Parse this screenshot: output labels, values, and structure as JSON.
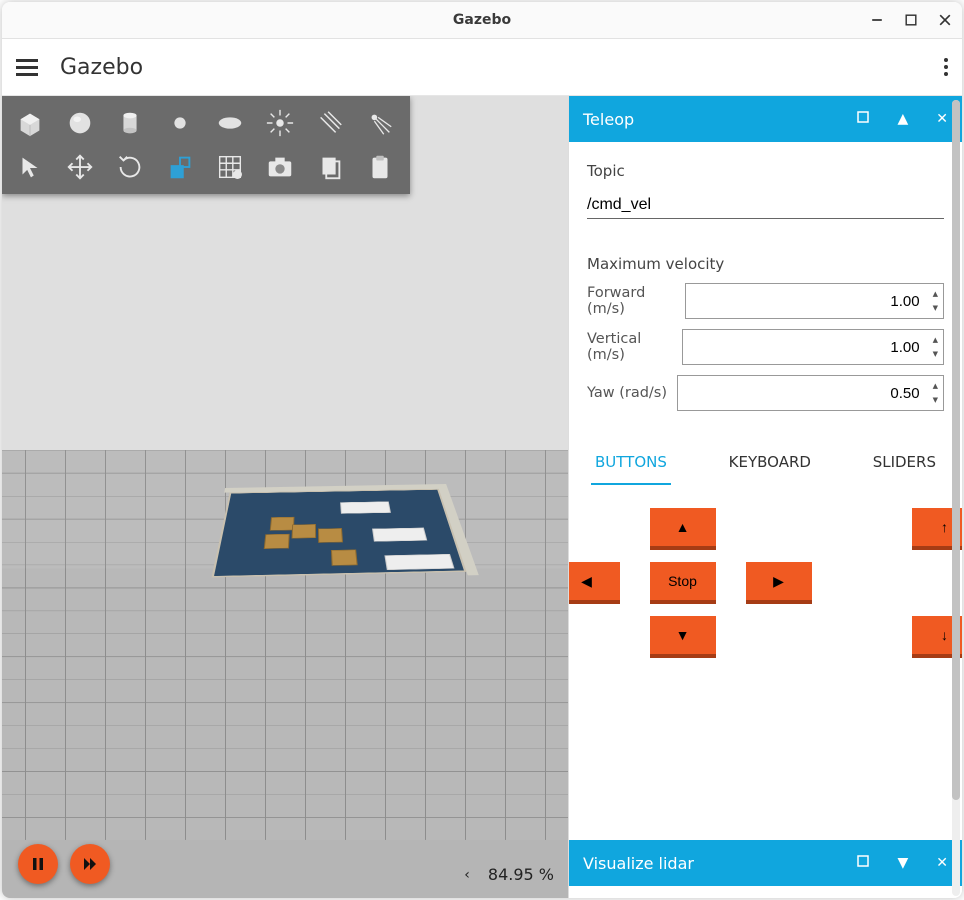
{
  "window": {
    "title": "Gazebo"
  },
  "appbar": {
    "title": "Gazebo"
  },
  "status": {
    "percent_label": "84.95 %"
  },
  "teleop": {
    "header": "Teleop",
    "topic_label": "Topic",
    "topic_value": "/cmd_vel",
    "max_vel_label": "Maximum velocity",
    "fields": {
      "forward": {
        "label": "Forward (m/s)",
        "value": "1.00"
      },
      "vertical": {
        "label": "Vertical (m/s)",
        "value": "1.00"
      },
      "yaw": {
        "label": "Yaw (rad/s)",
        "value": "0.50"
      }
    },
    "tabs": {
      "buttons": "BUTTONS",
      "keyboard": "KEYBOARD",
      "sliders": "SLIDERS"
    },
    "dpad": {
      "up": "▲",
      "down": "▼",
      "left": "◀",
      "right": "▶",
      "stop": "Stop",
      "ascend": "↑",
      "descend": "↓"
    }
  },
  "lidar": {
    "header": "Visualize lidar"
  }
}
